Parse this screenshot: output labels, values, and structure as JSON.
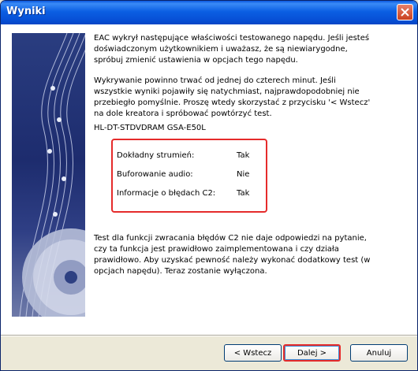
{
  "window": {
    "title": "Wyniki"
  },
  "content": {
    "paragraph1": "EAC wykrył następujące właściwości testowanego napędu. Jeśli jesteś doświadczonym użytkownikiem i uważasz, że są niewiarygodne, spróbuj zmienić ustawienia w opcjach tego napędu.",
    "paragraph2": "Wykrywanie powinno trwać od jednej do czterech minut. Jeśli wszystkie wyniki pojawiły się natychmiast, najprawdopodobniej nie przebiegło pomyślnie. Proszę wtedy skorzystać z przycisku '< Wstecz' na dole kreatora i spróbować powtórzyć test.",
    "device": "HL-DT-STDVDRAM GSA-E50L",
    "properties": [
      {
        "label": "Dokładny strumień:",
        "value": "Tak"
      },
      {
        "label": "Buforowanie audio:",
        "value": "Nie"
      },
      {
        "label": "Informacje o błędach C2:",
        "value": "Tak"
      }
    ],
    "paragraph3": "Test dla funkcji zwracania błędów C2 nie daje odpowiedzi na pytanie, czy ta funkcja jest prawidłowo zaimplementowana i czy działa prawidłowo. Aby uzyskać pewność należy wykonać dodatkowy test (w opcjach napędu). Teraz zostanie wyłączona."
  },
  "buttons": {
    "back": "< Wstecz",
    "next": "Dalej >",
    "cancel": "Anuluj"
  },
  "colors": {
    "highlight": "#e52b2b",
    "titlebar": "#0b5fe3"
  },
  "icons": {
    "close": "close-icon",
    "sidebar": "music-cd-graphic"
  }
}
